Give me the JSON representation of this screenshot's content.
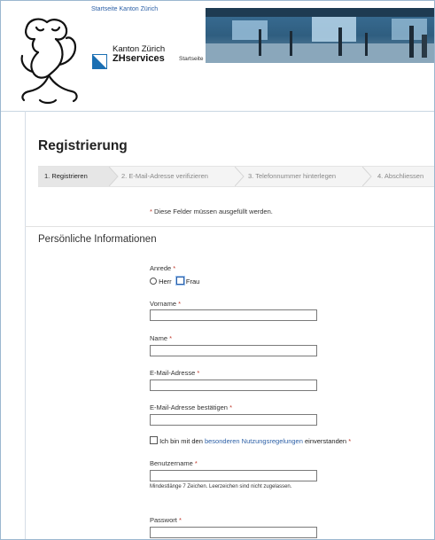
{
  "header": {
    "top_link": "Startseite Kanton Zürich",
    "canton_name": "Kanton Zürich",
    "service_name": "ZHservices",
    "startseite_small": "Startseite"
  },
  "page": {
    "title": "Registrierung"
  },
  "steps": [
    {
      "label": "1. Registrieren",
      "active": true
    },
    {
      "label": "2. E-Mail-Adresse verifizieren",
      "active": false
    },
    {
      "label": "3. Telefonnummer hinterlegen",
      "active": false
    },
    {
      "label": "4. Abschliessen",
      "active": false
    }
  ],
  "form": {
    "required_note": "Diese Felder müssen ausgefüllt werden.",
    "section_title": "Persönliche Informationen",
    "anrede_label": "Anrede",
    "anrede_options": [
      "Herr",
      "Frau"
    ],
    "vorname_label": "Vorname",
    "vorname_value": "",
    "name_label": "Name",
    "name_value": "",
    "email_label": "E-Mail-Adresse",
    "email_value": "",
    "email_confirm_label": "E-Mail-Adresse bestätigen",
    "email_confirm_value": "",
    "accept_pre": "Ich bin mit den",
    "accept_link": "besonderen Nutzungsregelungen",
    "accept_post": "einverstanden",
    "username_label": "Benutzername",
    "username_value": "",
    "username_hint": "Mindestlänge 7 Zeichen. Leerzeichen sind nicht zugelassen.",
    "password_label": "Passwort",
    "password_value": "",
    "required_marker": "*"
  },
  "colors": {
    "link": "#2b5fa6",
    "required": "#c0392b",
    "frame_border": "#9bb7cf"
  }
}
